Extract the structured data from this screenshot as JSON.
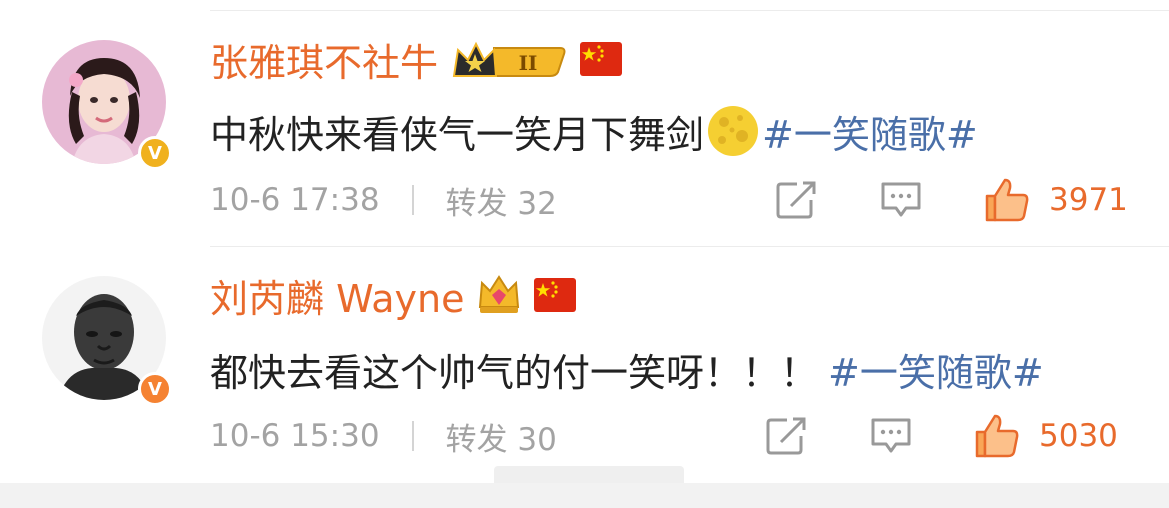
{
  "comments": [
    {
      "username": "张雅琪不社牛",
      "rank_badge": "II",
      "text": "中秋快来看侠气一笑月下舞剑",
      "emoji": "full-moon-face-icon",
      "hashtag": "#一笑随歌#",
      "timestamp": "10-6 17:38",
      "repost_label": "转发 32",
      "likes": "3971",
      "verified_color": "#f0b11e"
    },
    {
      "username": "刘芮麟 Wayne",
      "text": "都快去看这个帅气的付一笑呀！！！",
      "hashtag": "#一笑随歌#",
      "timestamp": "10-6 15:30",
      "repost_label": "转发 30",
      "likes": "5030",
      "verified_color": "#f58232"
    }
  ],
  "colors": {
    "username": "#e86a2c",
    "hashtag": "#4a6fa8",
    "meta": "#a3a3a3",
    "like": "#e86a2c"
  }
}
